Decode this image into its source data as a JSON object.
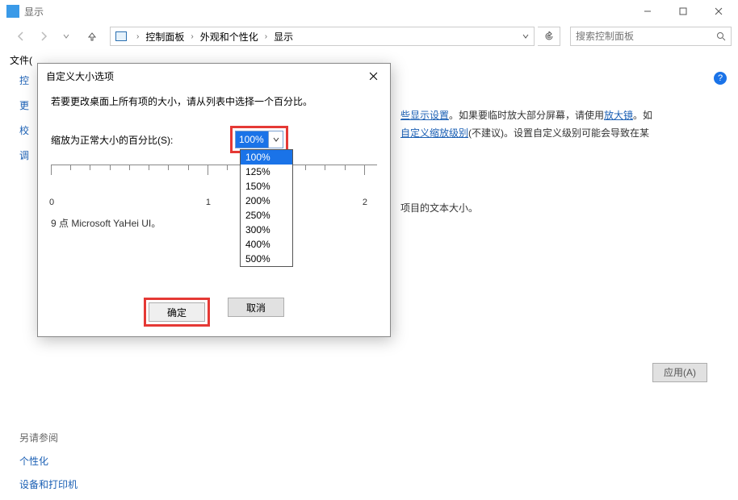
{
  "window": {
    "title": "显示",
    "min_tip": "最小化",
    "max_tip": "最大化",
    "close_tip": "关闭"
  },
  "nav": {
    "back_tip": "后退",
    "fwd_tip": "前进",
    "up_tip": "上一级"
  },
  "breadcrumb": {
    "items": [
      "控制面板",
      "外观和个性化",
      "显示"
    ]
  },
  "search": {
    "placeholder": "搜索控制面板"
  },
  "menu": {
    "file": "文件("
  },
  "sidebar": {
    "items": [
      "控",
      "更",
      "校",
      "调"
    ]
  },
  "main": {
    "link1": "些显示设置",
    "text1": "。如果要临时放大部分屏幕，请使用",
    "link2": "放大镜",
    "text2": "。如",
    "link3": "自定义缩放级别",
    "text3": "(不建议)。设置自定义级别可能会导致在某",
    "text4": "项目的文本大小。",
    "apply": "应用(A)"
  },
  "help": {
    "symbol": "?"
  },
  "footer": {
    "hdr": "另请参阅",
    "lnk1": "个性化",
    "lnk2": "设备和打印机"
  },
  "dialog": {
    "title": "自定义大小选项",
    "close_tip": "关闭",
    "desc": "若要更改桌面上所有项的大小，请从列表中选择一个百分比。",
    "scale_label": "缩放为正常大小的百分比(S):",
    "selected": "100%",
    "options": [
      "100%",
      "125%",
      "150%",
      "200%",
      "250%",
      "300%",
      "400%",
      "500%"
    ],
    "ruler_labels": [
      "0",
      "1",
      "2"
    ],
    "sample": "9 点 Microsoft YaHei UI。",
    "ok": "确定",
    "cancel": "取消"
  }
}
